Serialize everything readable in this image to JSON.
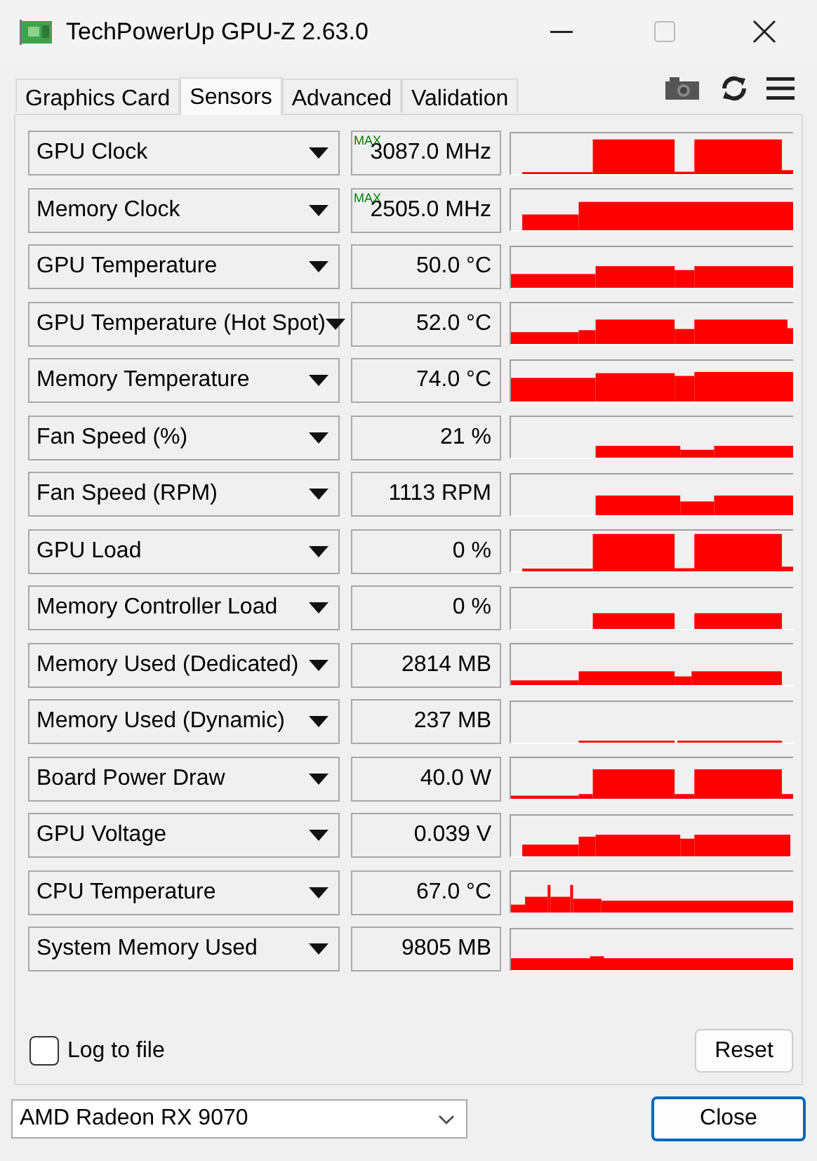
{
  "window": {
    "title": "TechPowerUp GPU-Z 2.63.0"
  },
  "tabs": [
    {
      "label": "Graphics Card",
      "selected": false
    },
    {
      "label": "Sensors",
      "selected": true
    },
    {
      "label": "Advanced",
      "selected": false
    },
    {
      "label": "Validation",
      "selected": false
    }
  ],
  "sensors": [
    {
      "name": "GPU Clock",
      "value": "3087.0 MHz",
      "max_label": "MAX"
    },
    {
      "name": "Memory Clock",
      "value": "2505.0 MHz",
      "max_label": "MAX"
    },
    {
      "name": "GPU Temperature",
      "value": "50.0 °C"
    },
    {
      "name": "GPU Temperature (Hot Spot)",
      "value": "52.0 °C"
    },
    {
      "name": "Memory Temperature",
      "value": "74.0 °C"
    },
    {
      "name": "Fan Speed (%)",
      "value": "21 %"
    },
    {
      "name": "Fan Speed (RPM)",
      "value": "1113 RPM"
    },
    {
      "name": "GPU Load",
      "value": "0 %"
    },
    {
      "name": "Memory Controller Load",
      "value": "0 %"
    },
    {
      "name": "Memory Used (Dedicated)",
      "value": "2814 MB"
    },
    {
      "name": "Memory Used (Dynamic)",
      "value": "237 MB"
    },
    {
      "name": "Board Power Draw",
      "value": "40.0 W"
    },
    {
      "name": "GPU Voltage",
      "value": "0.039 V"
    },
    {
      "name": "CPU Temperature",
      "value": "67.0 °C"
    },
    {
      "name": "System Memory Used",
      "value": "9805 MB"
    }
  ],
  "log_to_file": {
    "label": "Log to file",
    "checked": false
  },
  "reset_button": "Reset",
  "device_select": {
    "value": "AMD Radeon RX 9070"
  },
  "close_button": "Close"
}
